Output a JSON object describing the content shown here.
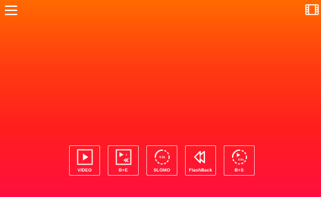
{
  "toolbar": {
    "menu_icon": "hamburger-menu-icon",
    "gallery_icon": "film-strip-icon"
  },
  "modes": [
    {
      "label": "VIDEO",
      "icon": "play-icon"
    },
    {
      "label": "B+E",
      "icon": "play-rewind-icon"
    },
    {
      "label": "SLOMO",
      "icon": "slowmo-dial-icon",
      "badge": "0.5x"
    },
    {
      "label": "FlashBack",
      "icon": "rewind-icon"
    },
    {
      "label": "B+S",
      "icon": "play-slowmo-icon",
      "badge": "0.5x"
    }
  ],
  "colors": {
    "gradient_top": "#ff6a00",
    "gradient_mid": "#ff2a15",
    "gradient_bottom": "#ff0f3e",
    "foreground": "#ffffff"
  }
}
